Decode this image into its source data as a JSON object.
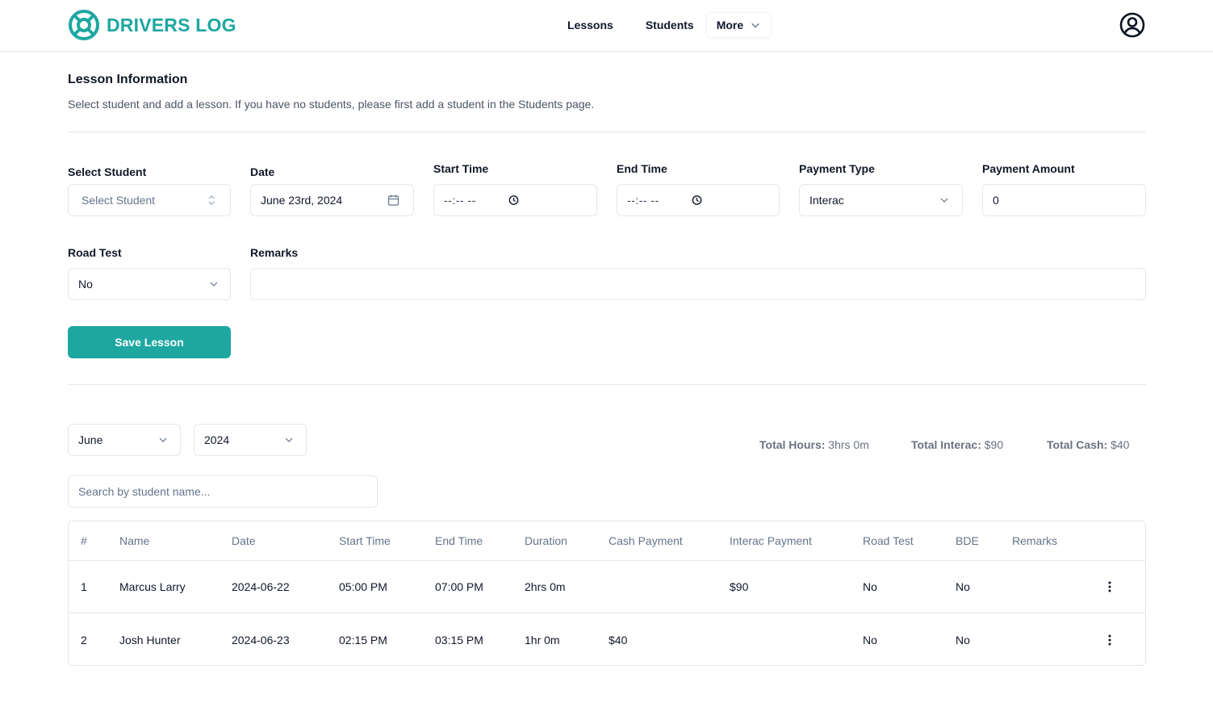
{
  "header": {
    "brand": "DRIVERS LOG",
    "brand_color": "#1ea7a1",
    "nav": [
      {
        "label": "Lessons"
      },
      {
        "label": "Students"
      },
      {
        "label": "More"
      }
    ],
    "account_icon": "user-circle-icon"
  },
  "lesson_info": {
    "title": "Lesson Information",
    "description": "Select student and add a lesson. If you have no students, please first add a student in the Students page."
  },
  "form": {
    "select_student": {
      "label": "Select Student",
      "placeholder": "Select Student",
      "value": ""
    },
    "date": {
      "label": "Date",
      "value": "June 23rd, 2024"
    },
    "start_time": {
      "label": "Start Time",
      "value": "--:-- --"
    },
    "end_time": {
      "label": "End Time",
      "value": "--:-- --"
    },
    "payment_type": {
      "label": "Payment Type",
      "value": "Interac"
    },
    "payment_amount": {
      "label": "Payment Amount",
      "value": "0"
    },
    "road_test": {
      "label": "Road Test",
      "value": "No"
    },
    "remarks": {
      "label": "Remarks",
      "value": ""
    },
    "save_label": "Save Lesson"
  },
  "filters": {
    "month": "June",
    "year": "2024",
    "search_placeholder": "Search by student name..."
  },
  "totals": {
    "hours_label": "Total Hours:",
    "hours_value": "3hrs 0m",
    "interac_label": "Total Interac:",
    "interac_value": "$90",
    "cash_label": "Total Cash:",
    "cash_value": "$40"
  },
  "table": {
    "columns": [
      "#",
      "Name",
      "Date",
      "Start Time",
      "End Time",
      "Duration",
      "Cash Payment",
      "Interac Payment",
      "Road Test",
      "BDE",
      "Remarks"
    ],
    "rows": [
      {
        "num": "1",
        "name": "Marcus Larry",
        "date": "2024-06-22",
        "start": "05:00 PM",
        "end": "07:00 PM",
        "duration": "2hrs 0m",
        "cash": "",
        "interac": "$90",
        "road_test": "No",
        "bde": "No",
        "remarks": ""
      },
      {
        "num": "2",
        "name": "Josh Hunter",
        "date": "2024-06-23",
        "start": "02:15 PM",
        "end": "03:15 PM",
        "duration": "1hr 0m",
        "cash": "$40",
        "interac": "",
        "road_test": "No",
        "bde": "No",
        "remarks": ""
      }
    ]
  }
}
